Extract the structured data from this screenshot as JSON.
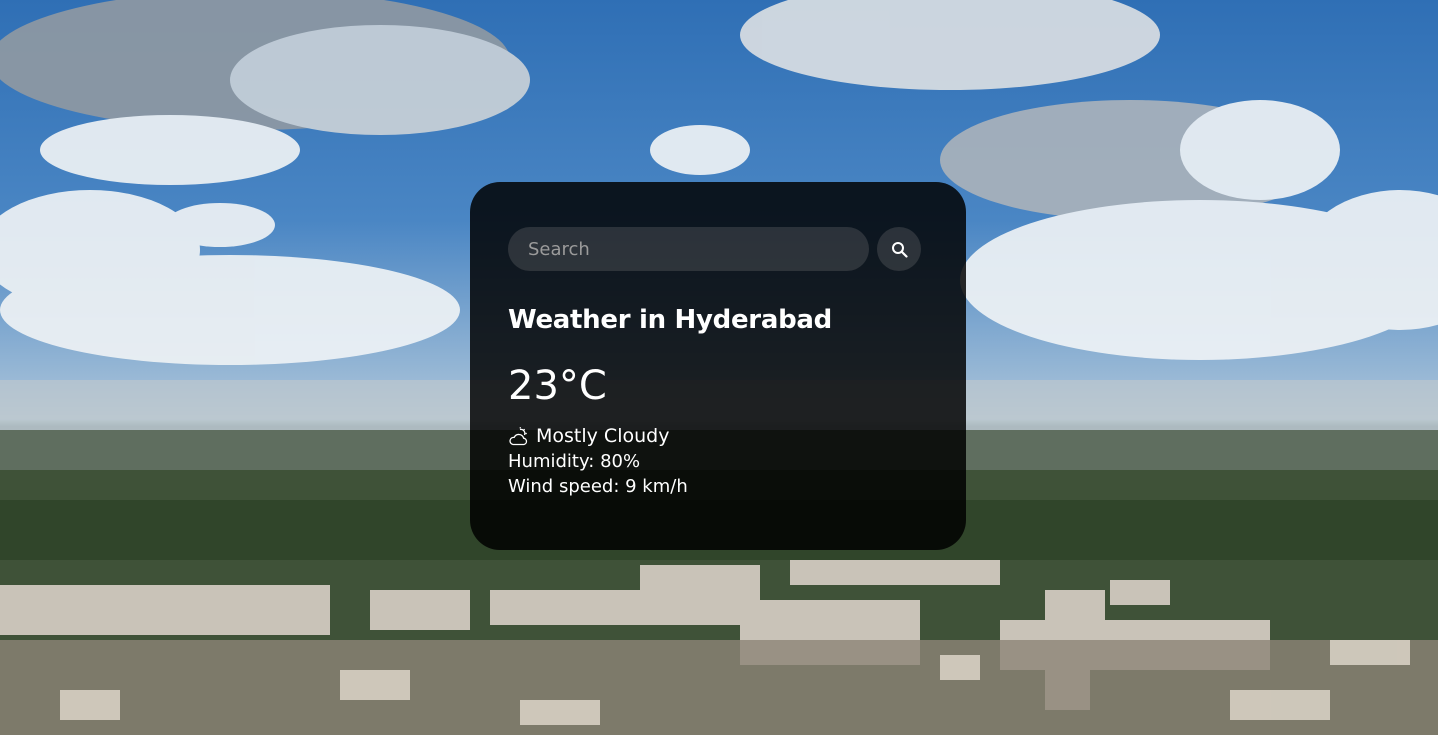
{
  "search": {
    "placeholder": "Search",
    "icon": "search-icon"
  },
  "weather": {
    "city_heading": "Weather in Hyderabad",
    "temperature": "23°C",
    "description_icon": "cloud-sun-icon",
    "description": "Mostly Cloudy",
    "humidity": "Humidity: 80%",
    "wind": "Wind speed: 9 km/h"
  },
  "colors": {
    "card_background": "#000000",
    "text": "#ffffff",
    "placeholder": "#9b9b9b"
  }
}
